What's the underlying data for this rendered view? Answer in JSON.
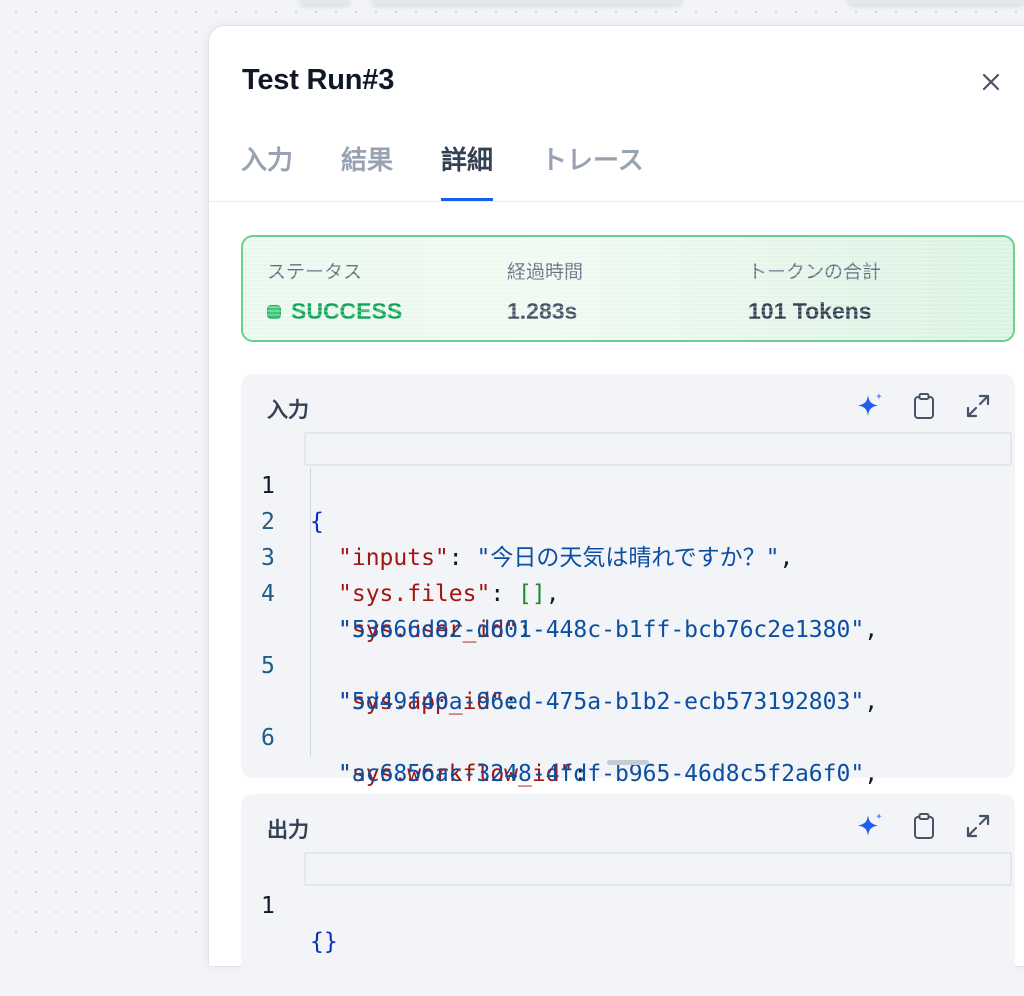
{
  "panel": {
    "title": "Test Run#3"
  },
  "tabs": [
    {
      "label": "入力",
      "active": false
    },
    {
      "label": "結果",
      "active": false
    },
    {
      "label": "詳細",
      "active": true
    },
    {
      "label": "トレース",
      "active": false
    }
  ],
  "status": {
    "status_label": "ステータス",
    "status_value": "SUCCESS",
    "elapsed_label": "経過時間",
    "elapsed_value": "1.283s",
    "tokens_label": "トークンの合計",
    "tokens_value": "101 Tokens"
  },
  "input_card": {
    "title": "入力",
    "lines": [
      {
        "n": "1"
      },
      {
        "n": "2",
        "key": "\"inputs\"",
        "value": "\"今日の天気は晴れですか？\""
      },
      {
        "n": "3",
        "key": "\"sys.files\"",
        "value": "[]"
      },
      {
        "n": "4",
        "key": "\"sys.user_id\"",
        "value": "\"53666d82-d601-448c-b1ff-bcb76c2e1380\""
      },
      {
        "n": "5",
        "key": "\"sys.app_id\"",
        "value": "\"5d49f40a-96ed-475a-b1b2-ecb573192803\""
      },
      {
        "n": "6",
        "key": "\"sys.workflow_id\"",
        "value": "\"ac6856ac-3248-4fdf-b965-46d8c5f2a6f0\""
      }
    ],
    "open_brace": "{"
  },
  "output_card": {
    "title": "出力",
    "lines": [
      {
        "n": "1",
        "code": "{}"
      }
    ]
  },
  "icons": {
    "sparkle": "sparkle-icon",
    "copy": "clipboard-icon",
    "expand": "expand-icon",
    "close": "close-icon"
  },
  "colors": {
    "accent": "#155eef",
    "success": "#12a557",
    "json_key": "#a31515",
    "json_string": "#0b4fa3"
  }
}
